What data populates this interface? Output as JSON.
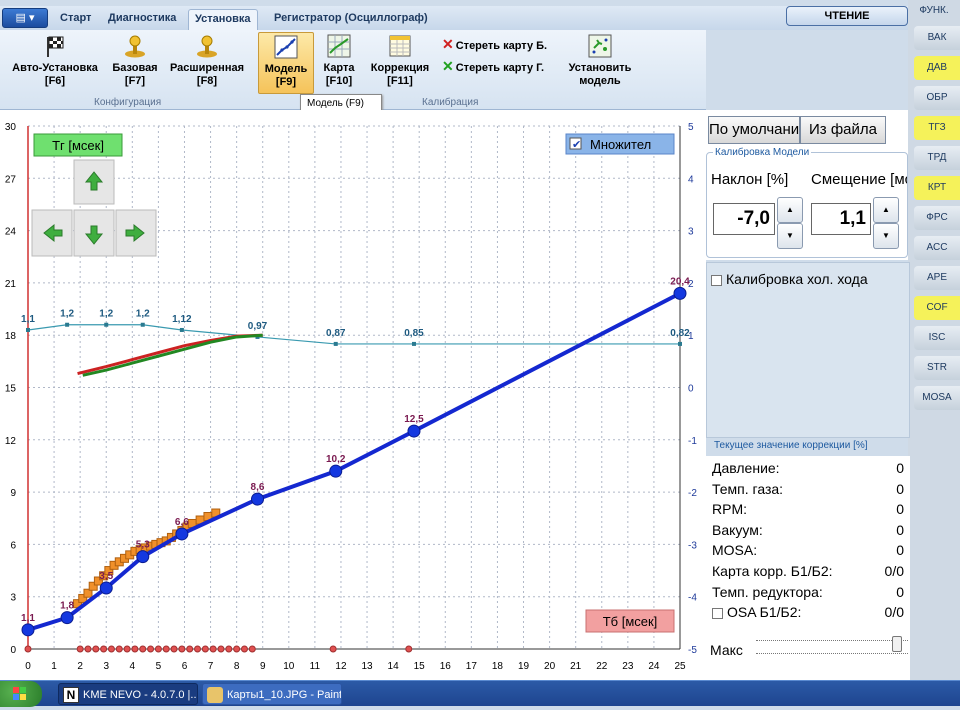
{
  "tabs": {
    "menu_icon": "menu-icon",
    "items": [
      "Старт",
      "Диагностика",
      "Установка",
      "Регистратор (Осциллограф)"
    ],
    "active": "Установка"
  },
  "mode": "ЧТЕНИЕ",
  "ribbon": {
    "config": {
      "label": "Конфигурация",
      "buttons": [
        {
          "line1": "Авто-Установка",
          "line2": "[F6]",
          "icon": "checkered-flag-icon"
        },
        {
          "line1": "Базовая",
          "line2": "[F7]",
          "icon": "joystick-icon"
        },
        {
          "line1": "Расширенная",
          "line2": "[F8]",
          "icon": "joystick-icon"
        }
      ]
    },
    "calib": {
      "label": "Калибрация",
      "buttons": [
        {
          "line1": "Модель",
          "line2": "[F9]",
          "icon": "chart-model-icon"
        },
        {
          "line1": "Карта",
          "line2": "[F10]",
          "icon": "map-grid-icon"
        },
        {
          "line1": "Коррекция",
          "line2": "[F11]",
          "icon": "table-icon"
        }
      ],
      "clear_b": "Стереть карту Б.",
      "clear_g": "Стереть карту Г.",
      "install_line1": "Установить",
      "install_line2": "модель"
    },
    "tooltip": "Модель (F9)"
  },
  "side": {
    "header": "ФУНК.",
    "buttons": [
      {
        "label": "ВАК",
        "hl": false
      },
      {
        "label": "ДАВ",
        "hl": true
      },
      {
        "label": "ОБР",
        "hl": false
      },
      {
        "label": "ТГЗ",
        "hl": true
      },
      {
        "label": "ТРД",
        "hl": false
      },
      {
        "label": "КРТ",
        "hl": true
      },
      {
        "label": "ФРС",
        "hl": false
      },
      {
        "label": "АСС",
        "hl": false
      },
      {
        "label": "АРЕ",
        "hl": false
      },
      {
        "label": "COF",
        "hl": true
      },
      {
        "label": "ISC",
        "hl": false
      },
      {
        "label": "STR",
        "hl": false
      },
      {
        "label": "MOSA",
        "hl": false
      }
    ]
  },
  "chart": {
    "tg_label": "Тг [мсек]",
    "tb_label": "Тб [мсек]",
    "multiplier_label": "Множител",
    "multiplier_checked": true
  },
  "chart_data": {
    "type": "line",
    "xlim": [
      0,
      25
    ],
    "ylim_left": [
      0,
      30
    ],
    "ylim_right": [
      -5,
      5
    ],
    "x_ticks": [
      0,
      1,
      2,
      3,
      4,
      5,
      6,
      7,
      8,
      9,
      10,
      11,
      12,
      13,
      14,
      15,
      16,
      17,
      18,
      19,
      20,
      21,
      22,
      23,
      24,
      25
    ],
    "y_ticks_left": [
      0,
      3,
      6,
      9,
      12,
      15,
      18,
      21,
      24,
      27,
      30
    ],
    "y_ticks_right": [
      -5,
      -4,
      -3,
      -2,
      -1,
      0,
      1,
      2,
      3,
      4,
      5
    ],
    "model": {
      "x": [
        0,
        1.5,
        3,
        4.4,
        5.9,
        8.8,
        11.8,
        14.8,
        25
      ],
      "y": [
        1.1,
        1.8,
        3.5,
        5.3,
        6.6,
        8.6,
        10.2,
        12.5,
        20.4
      ],
      "labels": [
        "1,1",
        "1,8",
        "3,5",
        "5,3",
        "6,6",
        "8,6",
        "10,2",
        "12,5",
        "20,4"
      ]
    },
    "multiplier": {
      "x": [
        0,
        1.5,
        3,
        4.4,
        5.9,
        8.8,
        11.8,
        14.8,
        25
      ],
      "y": [
        18.3,
        18.6,
        18.6,
        18.6,
        18.3,
        17.9,
        17.5,
        17.5,
        17.5
      ],
      "labels": [
        "1,1",
        "1,2",
        "1,2",
        "1,2",
        "1,12",
        "0,97",
        "0,87",
        "0,85",
        "0,82"
      ]
    },
    "samples": {
      "x": [
        1.9,
        2.1,
        2.3,
        2.5,
        2.7,
        2.9,
        3.1,
        3.3,
        3.5,
        3.7,
        3.9,
        4.1,
        4.3,
        4.5,
        4.7,
        4.9,
        5.1,
        5.3,
        5.5,
        5.7,
        5.9,
        6.1,
        6.3,
        6.6,
        6.9,
        7.2
      ],
      "y": [
        2.6,
        2.9,
        3.2,
        3.6,
        3.9,
        4.2,
        4.5,
        4.8,
        5.0,
        5.2,
        5.4,
        5.6,
        5.7,
        5.8,
        5.9,
        6.0,
        6.1,
        6.2,
        6.4,
        6.6,
        6.8,
        7.0,
        7.2,
        7.4,
        7.6,
        7.8
      ]
    },
    "baseline_points": [
      0,
      2,
      2.3,
      2.6,
      2.9,
      3.2,
      3.5,
      3.8,
      4.1,
      4.4,
      4.7,
      5,
      5.3,
      5.6,
      5.9,
      6.2,
      6.5,
      6.8,
      7.1,
      7.4,
      7.7,
      8,
      8.3,
      8.6,
      11.7,
      14.6
    ],
    "curve_red": {
      "x": [
        1.9,
        3,
        4,
        5,
        6,
        7,
        8,
        9
      ],
      "y": [
        15.8,
        16.2,
        16.6,
        17.0,
        17.4,
        17.7,
        17.95,
        18.0
      ]
    },
    "curve_green": {
      "x": [
        2.1,
        3,
        4,
        5,
        6,
        7,
        8,
        9
      ],
      "y": [
        15.7,
        16.0,
        16.4,
        16.8,
        17.2,
        17.6,
        17.9,
        18.0
      ]
    }
  },
  "calibration": {
    "default_btn": "По умолчанию",
    "file_btn": "Из файла",
    "title": "Калибровка Модели",
    "slope_label": "Наклон [%]",
    "offset_label": "Смещение [мсек]",
    "slope_value": "-7,0",
    "offset_value": "1,1"
  },
  "idle": {
    "label": "Калибровка хол. хода"
  },
  "correction_label": "Текущее значение коррекции [%]",
  "status": [
    {
      "label": "Давление:",
      "value": "0"
    },
    {
      "label": "Темп. газа:",
      "value": "0"
    },
    {
      "label": "RPM:",
      "value": "0"
    },
    {
      "label": "Вакуум:",
      "value": "0"
    },
    {
      "label": "MOSA:",
      "value": "0"
    },
    {
      "label": "Карта корр. Б1/Б2:",
      "value": "0/0"
    },
    {
      "label": "Темп. редуктора:",
      "value": "0"
    },
    {
      "label": "OSA Б1/Б2:",
      "value": "0/0"
    }
  ],
  "maks": "Макс",
  "taskbar": [
    {
      "label": "KME NEVO - 4.0.7.0  |...",
      "icon": "kme-app-icon"
    },
    {
      "label": "Карты1_10.JPG - Paint",
      "icon": "paint-icon"
    }
  ]
}
